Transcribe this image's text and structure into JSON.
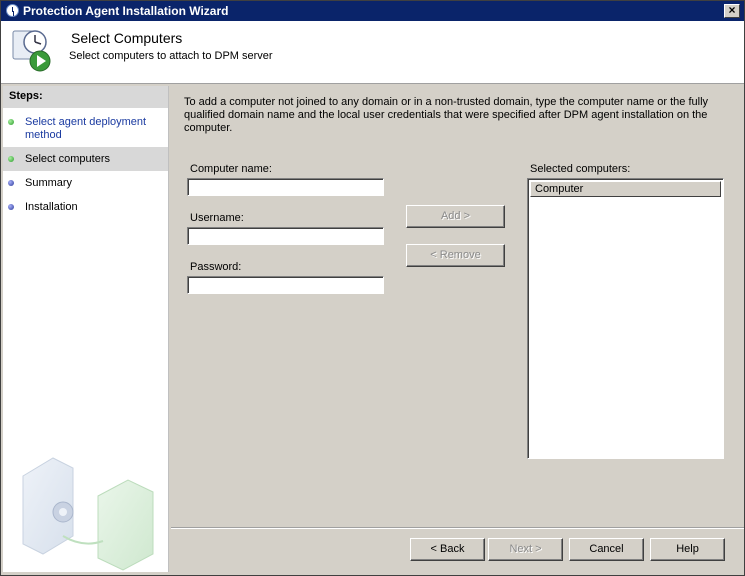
{
  "window": {
    "title": "Protection Agent Installation Wizard"
  },
  "header": {
    "title": "Select Computers",
    "subtitle": "Select computers to attach to DPM server"
  },
  "sidebar": {
    "heading": "Steps:",
    "items": [
      {
        "label": "Select agent deployment method",
        "status": "complete"
      },
      {
        "label": "Select computers",
        "status": "current"
      },
      {
        "label": "Summary",
        "status": "pending"
      },
      {
        "label": "Installation",
        "status": "pending"
      }
    ]
  },
  "main": {
    "intro": "To add a computer not joined to any domain or in a non-trusted domain, type the computer name or the fully qualified domain name and the local user credentials that were specified after DPM agent installation on the computer.",
    "computer_name_label": "Computer name:",
    "computer_name_value": "",
    "username_label": "Username:",
    "username_value": "",
    "password_label": "Password:",
    "password_value": "",
    "add_button": "Add >",
    "remove_button": "< Remove",
    "selected_label": "Selected computers:",
    "selected_column": "Computer",
    "selected_items": []
  },
  "footer": {
    "back": "< Back",
    "next": "Next >",
    "cancel": "Cancel",
    "help": "Help"
  },
  "colors": {
    "titlebar": "#0a246a",
    "step_complete": "#2a9a2a",
    "step_pending": "#2a3a9a",
    "link": "#1a3aa0"
  }
}
